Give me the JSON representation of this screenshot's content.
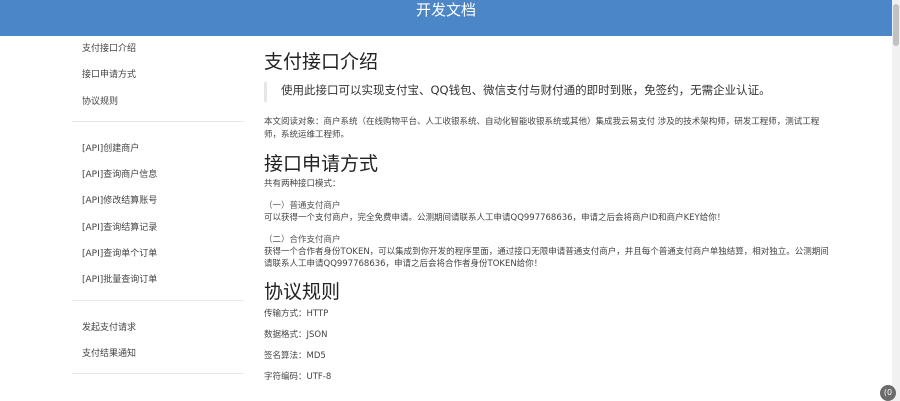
{
  "header": {
    "title": "开发文档"
  },
  "sidebar": {
    "groups": [
      {
        "items": [
          {
            "label": "支付接口介绍"
          },
          {
            "label": "接口申请方式"
          },
          {
            "label": "协议规则"
          }
        ]
      },
      {
        "items": [
          {
            "label": "[API]创建商户"
          },
          {
            "label": "[API]查询商户信息"
          },
          {
            "label": "[API]修改结算账号"
          },
          {
            "label": "[API]查询结算记录"
          },
          {
            "label": "[API]查询单个订单"
          },
          {
            "label": "[API]批量查询订单"
          }
        ]
      },
      {
        "items": [
          {
            "label": "发起支付请求"
          },
          {
            "label": "支付结果通知"
          }
        ]
      }
    ]
  },
  "main": {
    "intro": {
      "title": "支付接口介绍",
      "quote": "使用此接口可以实现支付宝、QQ钱包、微信支付与财付通的即时到账，免签约，无需企业认证。",
      "audience": "本文阅读对象：商户系统（在线购物平台、人工收银系统、自动化智能收银系统或其他）集成我云易支付 涉及的技术架构师，研发工程师，测试工程师，系统运维工程师。"
    },
    "apply": {
      "title": "接口申请方式",
      "intro": "共有两种接口模式：",
      "modes": [
        {
          "title": "（一）普通支付商户",
          "desc": "可以获得一个支付商户，完全免费申请。公测期间请联系人工申请QQ997768636，申请之后会将商户ID和商户KEY给你！"
        },
        {
          "title": "（二）合作支付商户",
          "desc": "获得一个合作者身份TOKEN，可以集成到你开发的程序里面，通过接口无限申请普通支付商户，并且每个普通支付商户单独结算，相对独立。公测期间请联系人工申请QQ997768636，申请之后会将合作者身份TOKEN给你！"
        }
      ]
    },
    "protocol": {
      "title": "协议规则",
      "rows": [
        {
          "text": "传输方式：HTTP"
        },
        {
          "text": "数据格式：JSON"
        },
        {
          "text": "签名算法：MD5"
        },
        {
          "text": "字符编码：UTF-8"
        }
      ]
    }
  },
  "corner_badge": {
    "text": "(0"
  }
}
